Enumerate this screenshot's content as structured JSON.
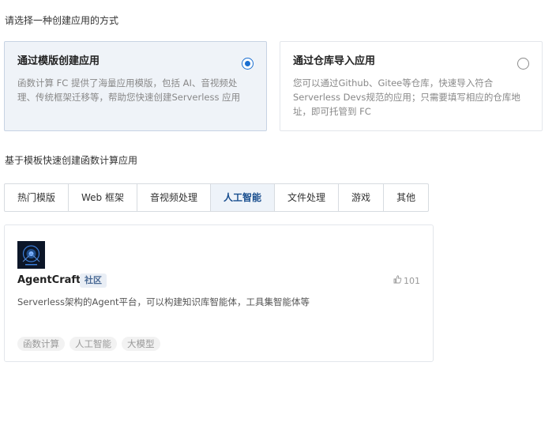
{
  "method_prompt": "请选择一种创建应用的方式",
  "methods": [
    {
      "title": "通过模版创建应用",
      "description": "函数计算 FC 提供了海量应用模版，包括 AI、音视频处理、传统框架迁移等，帮助您快速创建Serverless 应用",
      "selected": true
    },
    {
      "title": "通过仓库导入应用",
      "description": "您可以通过Github、Gitee等仓库，快速导入符合Serverless Devs规范的应用；只需要填写相应的仓库地址，即可托管到 FC",
      "selected": false
    }
  ],
  "template_prompt": "基于模板快速创建函数计算应用",
  "tabs": [
    {
      "label": "热门模版"
    },
    {
      "label": "Web 框架"
    },
    {
      "label": "音视频处理"
    },
    {
      "label": "人工智能",
      "active": true
    },
    {
      "label": "文件处理"
    },
    {
      "label": "游戏"
    },
    {
      "label": "其他"
    }
  ],
  "app": {
    "name": "AgentCraft",
    "tag": "社区",
    "likes": "101",
    "description": "Serverless架构的Agent平台，可以构建知识库智能体，工具集智能体等",
    "keywords": [
      "函数计算",
      "人工智能",
      "大模型"
    ]
  },
  "colors": {
    "accent": "#1b6fd1",
    "selected_card_bg": "#eff3f8",
    "active_tab_bg": "#eef3f9"
  }
}
